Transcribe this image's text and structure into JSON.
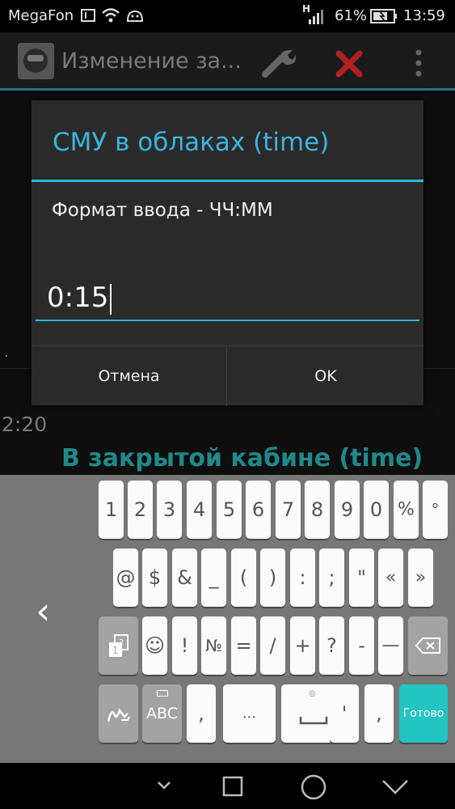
{
  "status": {
    "carrier": "MegaFon",
    "battery": "61%",
    "time": "13:59",
    "network": "H"
  },
  "actionbar": {
    "title": "Изменение за..."
  },
  "background": {
    "row_value": "2:20",
    "next_title": "В закрытой кабине (time)",
    "dot": "."
  },
  "dialog": {
    "title": "СМУ в облаках (time)",
    "message": "Формат ввода - ЧЧ:ММ",
    "input_value": "0:15",
    "cancel": "Отмена",
    "ok": "OK"
  },
  "keyboard": {
    "row1": [
      "1",
      "2",
      "3",
      "4",
      "5",
      "6",
      "7",
      "8",
      "9",
      "0",
      "%",
      "°"
    ],
    "row2": [
      "@",
      "$",
      "&",
      "_",
      "(",
      ")",
      ":",
      ";",
      "\"",
      "«",
      "»"
    ],
    "row3": [
      "☺",
      "!",
      "№",
      "=",
      "/",
      "+",
      "?",
      "-",
      "—"
    ],
    "abc": "ABC",
    "comma": ",",
    "ellipsis": "...",
    "apostrophe": "'",
    "done": "Готово",
    "back_arrow": "‹"
  },
  "colors": {
    "accent": "#33b5e5",
    "next_title": "#1e8a8a",
    "done_key": "#22c4c4"
  }
}
